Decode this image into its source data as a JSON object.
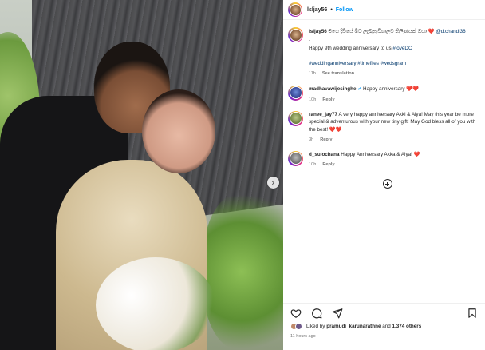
{
  "post": {
    "username": "lsljay56",
    "follow_label": "Follow",
    "more_label": "···",
    "dot": "•"
  },
  "caption": {
    "username": "lsljay56",
    "text_sinhala": "මගෙ දිවියේ මිට ලැබුනු විශාලම තිලිණයක් ඔයා",
    "heart": "❤️",
    "mention": "@d.chandi36",
    "dot_line": ".",
    "anniversary": "Happy 9th wedding anniversary to us",
    "hashtag_1": "#loveDC",
    "hashtags_2": "#weddinganniversary #timeflies #wedsgram",
    "time": "11h",
    "translation": "See translation"
  },
  "comments": [
    {
      "username": "madhavawijesinghe",
      "verified": "✔",
      "text": "Happy anniversary",
      "hearts": "❤️❤️"
    },
    {
      "username": "ranee_jay77",
      "text": "A very happy anniversary Akki & Aiya! May this year be more special & adventurous with your new tiny gift! May God bless all of you with the best!",
      "hearts": "❤️❤️",
      "time": "3h",
      "reply": "Reply"
    },
    {
      "username": "d_sulochana",
      "text": "Happy Anniversary Akka & Aiya!",
      "hearts": "❤️",
      "time": "10h",
      "reply": "Reply"
    }
  ],
  "comment0_meta": {
    "time": "10h",
    "reply": "Reply"
  },
  "footer": {
    "liked_by_prefix": "Liked by",
    "liked_by_user": "pramudi_karunarathne",
    "and": "and",
    "others": "1,374 others",
    "time_ago": "11 hours ago"
  },
  "icons": {
    "next": "chevron-right-icon",
    "comment_heart": "heart-outline-icon",
    "load_more": "plus-circle-icon"
  },
  "colors": {
    "link_blue": "#0095f6",
    "hashtag": "#00376b",
    "heart_red": "#ed4956",
    "muted": "#737373"
  }
}
